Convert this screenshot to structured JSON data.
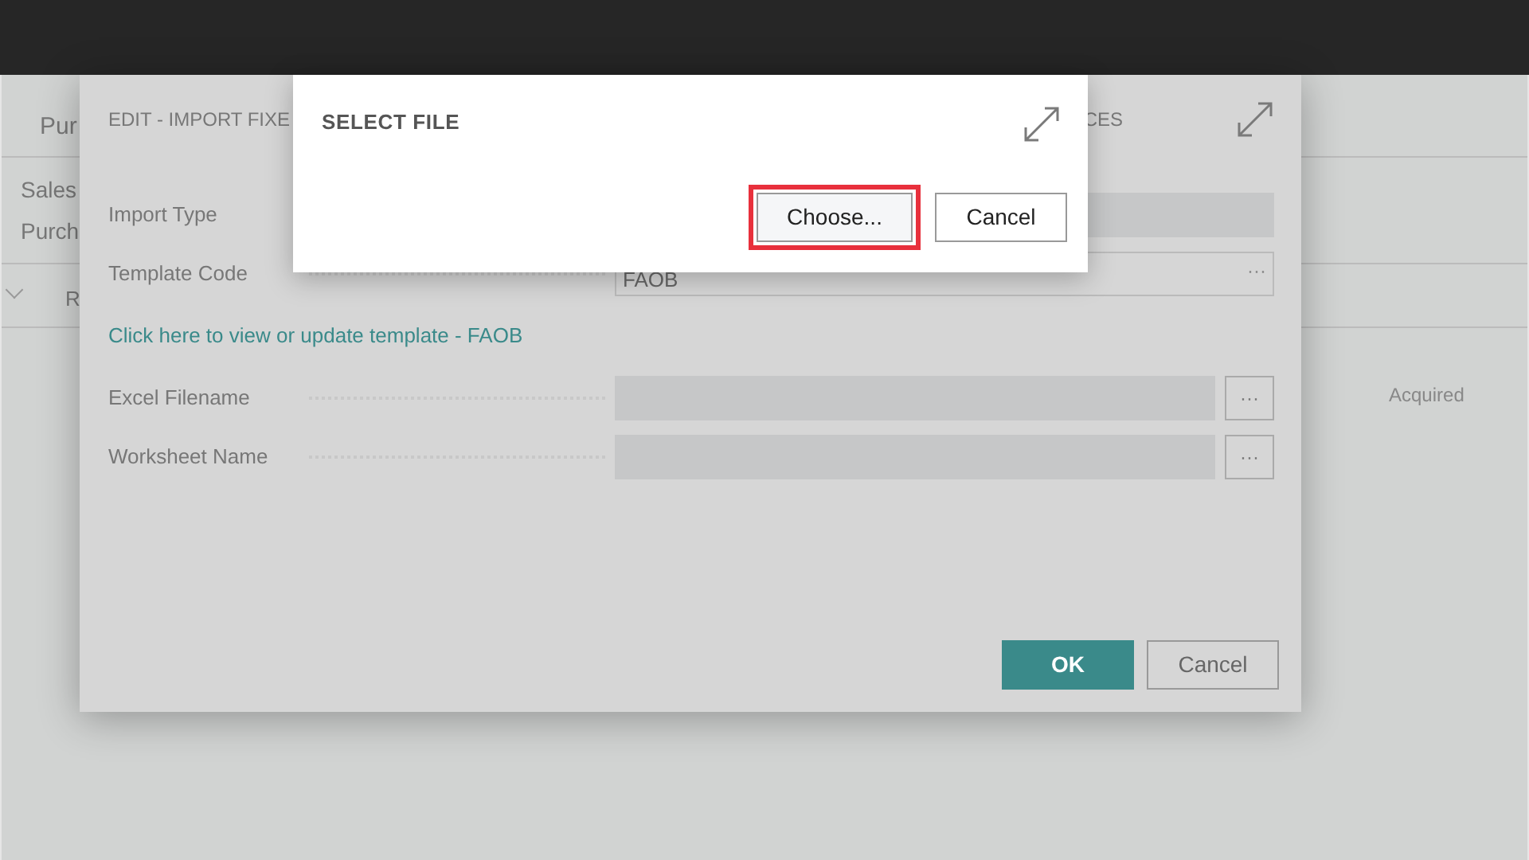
{
  "background_page": {
    "tab": "Pur",
    "lines": [
      "Sales",
      "Purch"
    ],
    "column_header": "R",
    "cell": "Acquired"
  },
  "edit_dialog": {
    "title_start": "EDIT - IMPORT FIXE",
    "title_end": "CES",
    "fields": [
      {
        "label": "Import Type",
        "kind": "dropdown"
      },
      {
        "label": "Template Code",
        "kind": "lookup",
        "value": "FAOB"
      },
      {
        "kind": "link",
        "label": "Click here to view or update template - FAOB"
      },
      {
        "label": "Excel Filename",
        "kind": "assist",
        "button": "···"
      },
      {
        "label": "Worksheet Name",
        "kind": "assist",
        "button": "···"
      }
    ],
    "lookup_button": "···",
    "buttons": [
      {
        "label": "OK",
        "primary": true
      },
      {
        "label": "Cancel",
        "primary": false
      }
    ]
  },
  "select_file_dialog": {
    "title": "SELECT FILE",
    "buttons": [
      {
        "label": "Choose...",
        "highlighted": true
      },
      {
        "label": "Cancel",
        "highlighted": false
      }
    ]
  }
}
